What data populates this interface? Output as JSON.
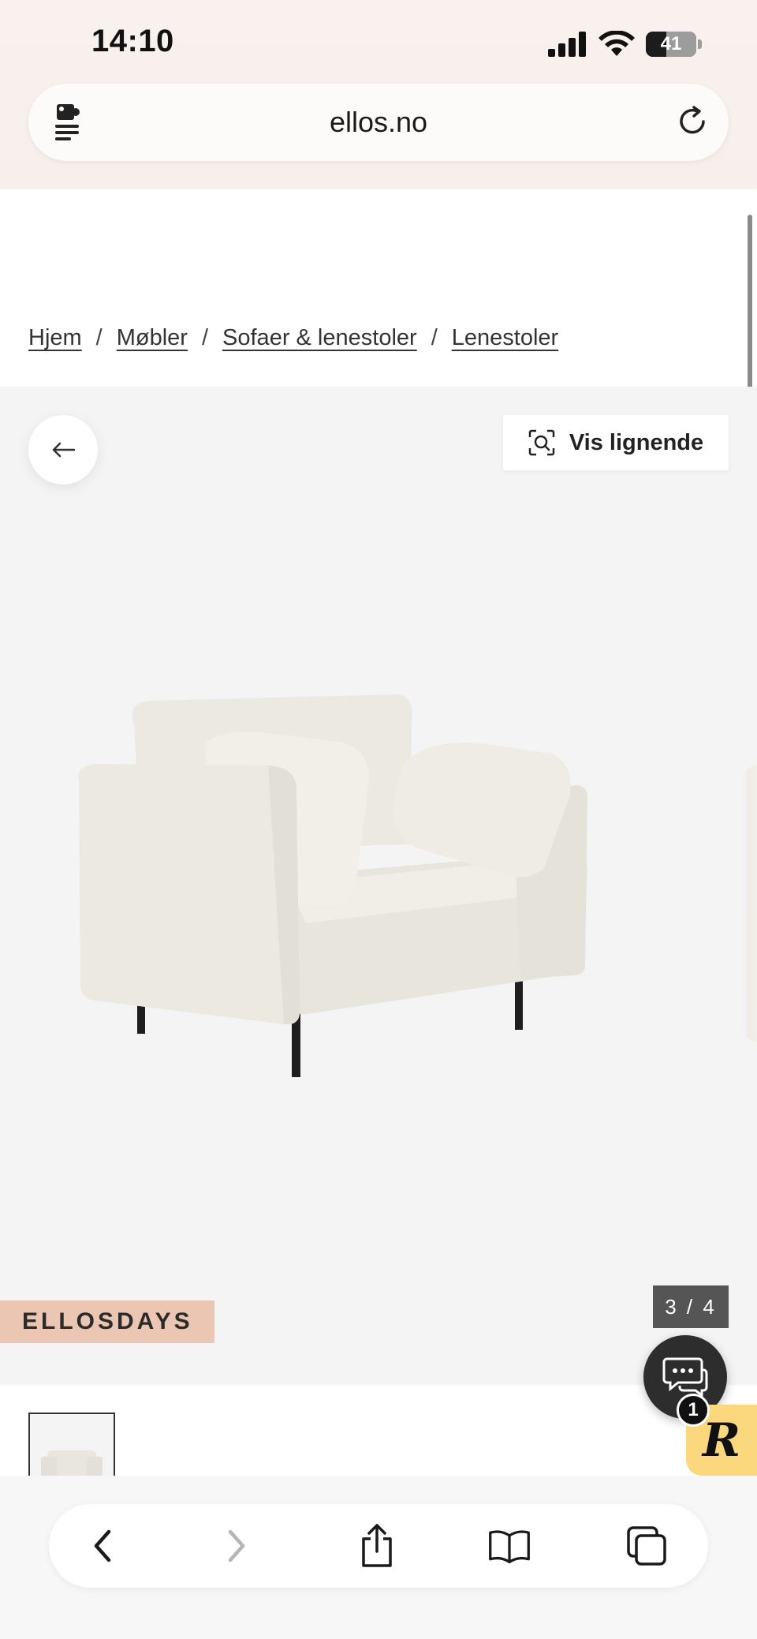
{
  "status_bar": {
    "time": "14:10",
    "battery_level": "41"
  },
  "browser": {
    "url": "ellos.no"
  },
  "breadcrumb": {
    "items": [
      "Hjem",
      "Møbler",
      "Sofaer & lenestoler",
      "Lenestoler"
    ],
    "separator": "/"
  },
  "gallery": {
    "similar_label": "Vis lignende",
    "promo_badge": "ELLOSDAYS",
    "counter": "3 / 4"
  },
  "chat": {
    "badge_count": "1"
  },
  "widget": {
    "letter": "R"
  },
  "colors": {
    "promo_badge_bg": "#ebc6b3",
    "counter_bg": "#555555",
    "chat_bg": "#2d2d2d",
    "widget_bg": "#fbd77e",
    "gallery_bg": "#f4f4f4"
  },
  "icons": {
    "url_left": "extension-menu-icon",
    "reload": "reload-icon",
    "back": "arrow-left-icon",
    "similar": "visual-search-icon",
    "chat": "chat-bubbles-icon",
    "toolbar": [
      "back-icon",
      "forward-icon",
      "share-icon",
      "bookmarks-icon",
      "tabs-icon"
    ]
  }
}
